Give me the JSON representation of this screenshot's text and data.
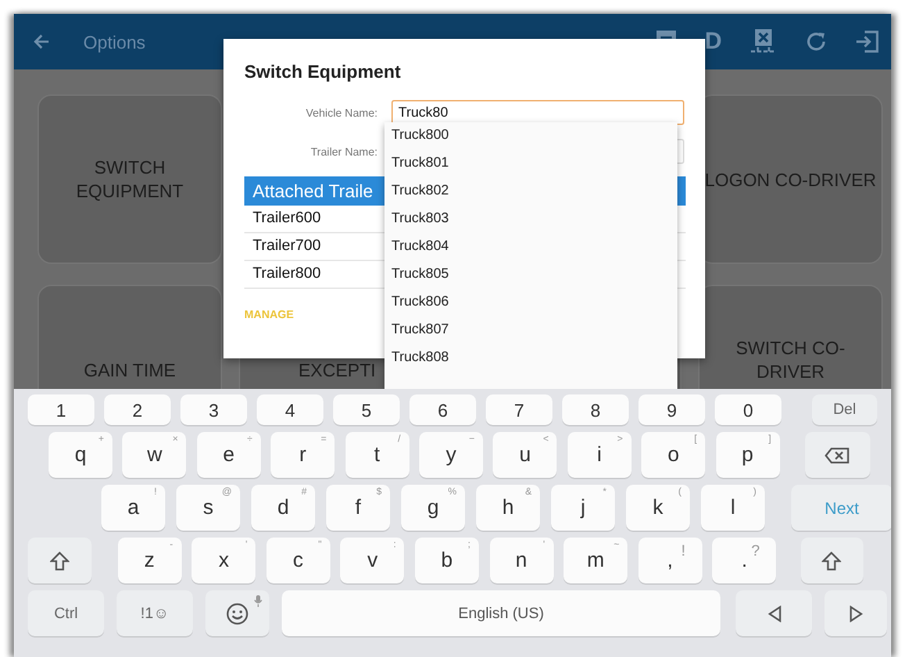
{
  "app_bar": {
    "title": "Options",
    "badge_letter": "D"
  },
  "tiles": [
    {
      "label": "SWITCH EQUIPMENT"
    },
    {
      "label": "LOGON CO-DRIVER"
    },
    {
      "label": "GAIN TIME"
    },
    {
      "label": "EXCEPTI"
    },
    {
      "label": "SWITCH CO-DRIVER"
    }
  ],
  "dialog": {
    "title": "Switch Equipment",
    "fields": [
      {
        "label": "Vehicle Name:",
        "value": "Truck80",
        "focused": true
      },
      {
        "label": "Trailer Name:",
        "focused": false
      }
    ],
    "table": {
      "header": "Attached Traile",
      "rows": [
        "Trailer600",
        "Trailer700",
        "Trailer800"
      ]
    },
    "action": "MANAGE"
  },
  "suggestions": [
    "Truck800",
    "Truck801",
    "Truck802",
    "Truck803",
    "Truck804",
    "Truck805",
    "Truck806",
    "Truck807",
    "Truck808"
  ],
  "keyboard": {
    "number_row": [
      {
        "kind": "num",
        "label": "1"
      },
      {
        "kind": "num",
        "label": "2"
      },
      {
        "kind": "num",
        "label": "3"
      },
      {
        "kind": "num",
        "label": "4"
      },
      {
        "kind": "num",
        "label": "5"
      },
      {
        "kind": "num",
        "label": "6"
      },
      {
        "kind": "num",
        "label": "7"
      },
      {
        "kind": "num",
        "label": "8"
      },
      {
        "kind": "num",
        "label": "9"
      },
      {
        "kind": "num",
        "label": "0"
      },
      {
        "kind": "action",
        "label": "Del"
      }
    ],
    "upper_letter_row": [
      {
        "kind": "char",
        "label": "q",
        "hint": "+"
      },
      {
        "kind": "char",
        "label": "w",
        "hint": "×"
      },
      {
        "kind": "char",
        "label": "e",
        "hint": "÷"
      },
      {
        "kind": "char",
        "label": "r",
        "hint": "="
      },
      {
        "kind": "char",
        "label": "t",
        "hint": "/"
      },
      {
        "kind": "char",
        "label": "y",
        "hint": "−"
      },
      {
        "kind": "char",
        "label": "u",
        "hint": "<"
      },
      {
        "kind": "char",
        "label": "i",
        "hint": ">"
      },
      {
        "kind": "char",
        "label": "o",
        "hint": "["
      },
      {
        "kind": "char",
        "label": "p",
        "hint": "]"
      },
      {
        "kind": "backspace"
      }
    ],
    "middle_letter_row": [
      {
        "kind": "char",
        "label": "a",
        "hint": "!"
      },
      {
        "kind": "char",
        "label": "s",
        "hint": "@"
      },
      {
        "kind": "char",
        "label": "d",
        "hint": "#"
      },
      {
        "kind": "char",
        "label": "f",
        "hint": "$"
      },
      {
        "kind": "char",
        "label": "g",
        "hint": "%"
      },
      {
        "kind": "char",
        "label": "h",
        "hint": "&"
      },
      {
        "kind": "char",
        "label": "j",
        "hint": "*"
      },
      {
        "kind": "char",
        "label": "k",
        "hint": "("
      },
      {
        "kind": "char",
        "label": "l",
        "hint": ")"
      },
      {
        "kind": "accent",
        "label": "Next"
      }
    ],
    "lower_letter_row": [
      {
        "kind": "shift"
      },
      {
        "kind": "char",
        "label": "z",
        "hint": "-"
      },
      {
        "kind": "char",
        "label": "x",
        "hint": "'"
      },
      {
        "kind": "char",
        "label": "c",
        "hint": "\""
      },
      {
        "kind": "char",
        "label": "v",
        "hint": ":"
      },
      {
        "kind": "char",
        "label": "b",
        "hint": ";"
      },
      {
        "kind": "char",
        "label": "n",
        "hint": "'"
      },
      {
        "kind": "char",
        "label": "m",
        "hint": "~"
      },
      {
        "kind": "punct",
        "label": ",",
        "hint": "!"
      },
      {
        "kind": "punct",
        "label": ".",
        "hint": "?"
      },
      {
        "kind": "shift"
      }
    ],
    "bottom_row": [
      {
        "kind": "action",
        "label": "Ctrl"
      },
      {
        "kind": "action",
        "label": "!1☺"
      },
      {
        "kind": "emoji"
      },
      {
        "kind": "space",
        "label": "English (US)"
      },
      {
        "kind": "left"
      },
      {
        "kind": "right"
      }
    ]
  }
}
